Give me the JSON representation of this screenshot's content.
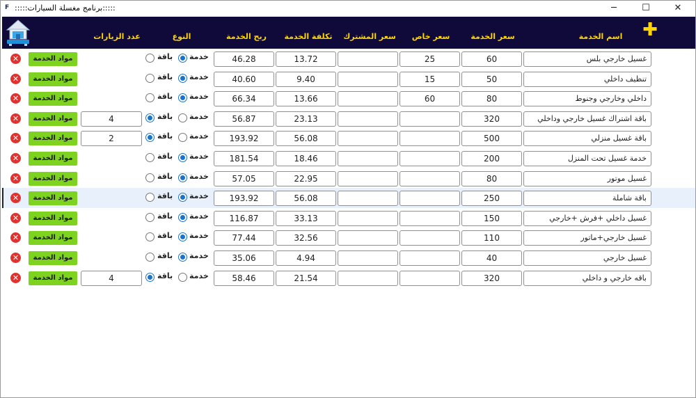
{
  "window": {
    "title": ":::::برنامج مغسلة السيارات:::::",
    "minimize": "─",
    "maximize": "☐",
    "close": "✕"
  },
  "header": {
    "add_label": "✚",
    "columns": {
      "name": "اسم الخدمة",
      "price": "سعر الخدمة",
      "special_price": "سعر خاص",
      "subscriber_price": "سعر المشترك",
      "cost": "تكلفة الخدمة",
      "profit": "ربح الخدمة",
      "type": "النوع",
      "visits": "عدد الزيارات"
    }
  },
  "labels": {
    "service": "خدمة",
    "package": "باقة",
    "materials_button": "مواد الخدمة",
    "delete_icon": "✕"
  },
  "rows": [
    {
      "name": "غسيل خارجي بلس",
      "price": "60",
      "special_price": "25",
      "subscriber_price": "",
      "cost": "13.72",
      "profit": "46.28",
      "type": "service",
      "visits": ""
    },
    {
      "name": "تنظيف داخلي",
      "price": "50",
      "special_price": "15",
      "subscriber_price": "",
      "cost": "9.40",
      "profit": "40.60",
      "type": "service",
      "visits": ""
    },
    {
      "name": "داخلي وخارجي وجنوط",
      "price": "80",
      "special_price": "60",
      "subscriber_price": "",
      "cost": "13.66",
      "profit": "66.34",
      "type": "service",
      "visits": ""
    },
    {
      "name": "باقة اشتراك غسيل خارجي وداخلي",
      "price": "320",
      "special_price": "",
      "subscriber_price": "",
      "cost": "23.13",
      "profit": "56.87",
      "type": "package",
      "visits": "4"
    },
    {
      "name": "باقة غسيل منزلي",
      "price": "500",
      "special_price": "",
      "subscriber_price": "",
      "cost": "56.08",
      "profit": "193.92",
      "type": "package",
      "visits": "2"
    },
    {
      "name": "خدمة غسيل تحت المنزل",
      "price": "200",
      "special_price": "",
      "subscriber_price": "",
      "cost": "18.46",
      "profit": "181.54",
      "type": "service",
      "visits": ""
    },
    {
      "name": "غسيل موتور",
      "price": "80",
      "special_price": "",
      "subscriber_price": "",
      "cost": "22.95",
      "profit": "57.05",
      "type": "service",
      "visits": ""
    },
    {
      "name": "باقة شاملة",
      "price": "250",
      "special_price": "",
      "subscriber_price": "",
      "cost": "56.08",
      "profit": "193.92",
      "type": "service",
      "visits": "",
      "selected": true
    },
    {
      "name": "غسيل داخلي +فرش +خارجي",
      "price": "150",
      "special_price": "",
      "subscriber_price": "",
      "cost": "33.13",
      "profit": "116.87",
      "type": "service",
      "visits": ""
    },
    {
      "name": "غسيل خارجي+ماتور",
      "price": "110",
      "special_price": "",
      "subscriber_price": "",
      "cost": "32.56",
      "profit": "77.44",
      "type": "service",
      "visits": ""
    },
    {
      "name": "غسيل خارجي",
      "price": "40",
      "special_price": "",
      "subscriber_price": "",
      "cost": "4.94",
      "profit": "35.06",
      "type": "service",
      "visits": ""
    },
    {
      "name": "باقه خارجي و داخلي",
      "price": "320",
      "special_price": "",
      "subscriber_price": "",
      "cost": "21.54",
      "profit": "58.46",
      "type": "package",
      "visits": "4"
    }
  ]
}
